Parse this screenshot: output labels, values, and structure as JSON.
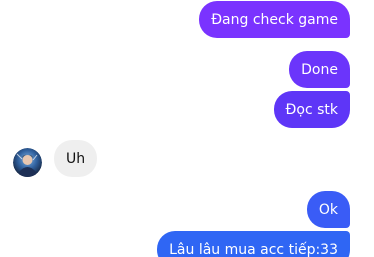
{
  "messages": [
    {
      "text": "Đang check game",
      "direction": "outgoing"
    },
    {
      "text": "Done",
      "direction": "outgoing"
    },
    {
      "text": "Đọc stk",
      "direction": "outgoing"
    },
    {
      "text": "Uh",
      "direction": "incoming"
    },
    {
      "text": "Ok",
      "direction": "outgoing"
    },
    {
      "text": "Lâu lâu mua acc tiếp:33",
      "direction": "outgoing"
    }
  ],
  "colors": {
    "outgoing_purple": "#7a33ff",
    "outgoing_blue": "#2f66f4",
    "incoming_bg": "#efefef"
  },
  "icons": {
    "contact_avatar": "avatar-image"
  }
}
